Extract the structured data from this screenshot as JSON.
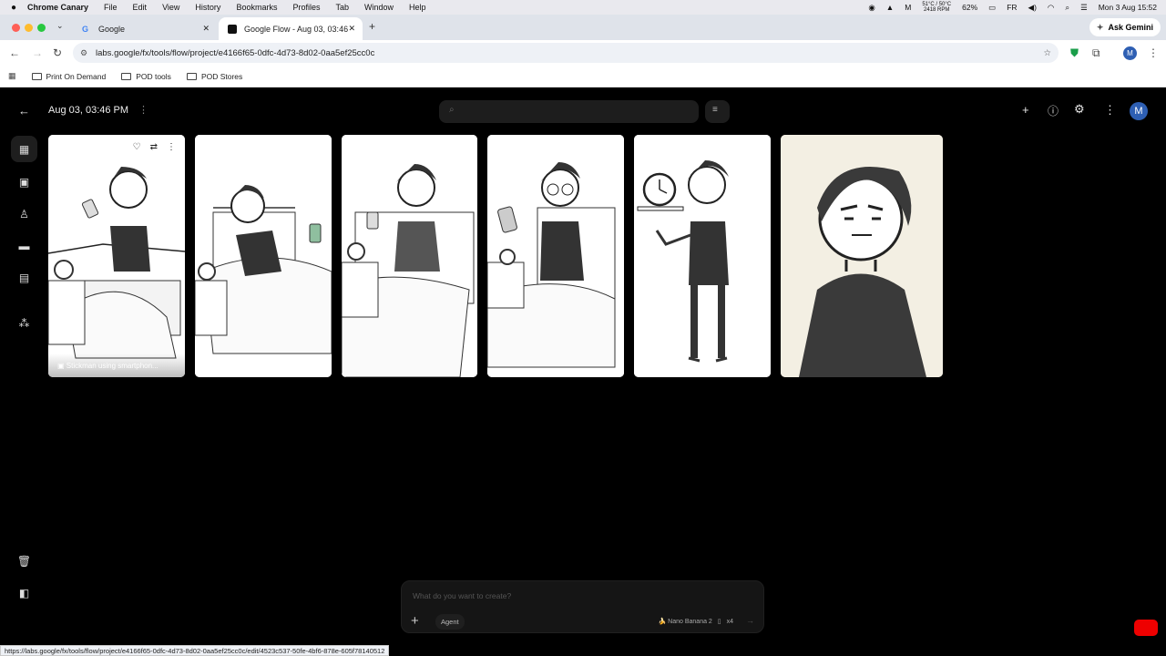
{
  "macos_menubar": {
    "app_name": "Chrome Canary",
    "menus": [
      "File",
      "Edit",
      "View",
      "History",
      "Bookmarks",
      "Profiles",
      "Tab",
      "Window",
      "Help"
    ],
    "temp_line1": "51°C / 50°C",
    "temp_line2": "2418 RPM",
    "battery": "62%",
    "input_source": "FR",
    "datetime": "Mon 3 Aug  15:52"
  },
  "browser": {
    "tabs": [
      {
        "title": "Google"
      },
      {
        "title": "Google Flow - Aug 03, 03:46"
      }
    ],
    "ask_gemini": "Ask Gemini",
    "url": "labs.google/fx/tools/flow/project/e4166f65-0dfc-4d73-8d02-0aa5ef25cc0c",
    "profile_letter": "M",
    "bookmarks": [
      "Print On Demand",
      "POD tools",
      "POD Stores"
    ],
    "status_url": "https://labs.google/fx/tools/flow/project/e4166f65-0dfc-4d73-8d02-0aa5ef25cc0c/edit/4523c537-50fe-4bf6-878e-605f78140512"
  },
  "flow": {
    "project_title": "Aug 03, 03:46 PM",
    "avatar_letter": "M",
    "cards": [
      {
        "caption": "Stickman using smartphon..."
      }
    ],
    "prompt": {
      "placeholder": "What do you want to create?",
      "agent_label": "Agent",
      "model_label": "🍌 Nano Banana 2",
      "count_label": "x4"
    }
  },
  "colors": {
    "accent_blue": "#2e5fb3",
    "app_background": "#000000",
    "youtube_red": "#e00000"
  }
}
